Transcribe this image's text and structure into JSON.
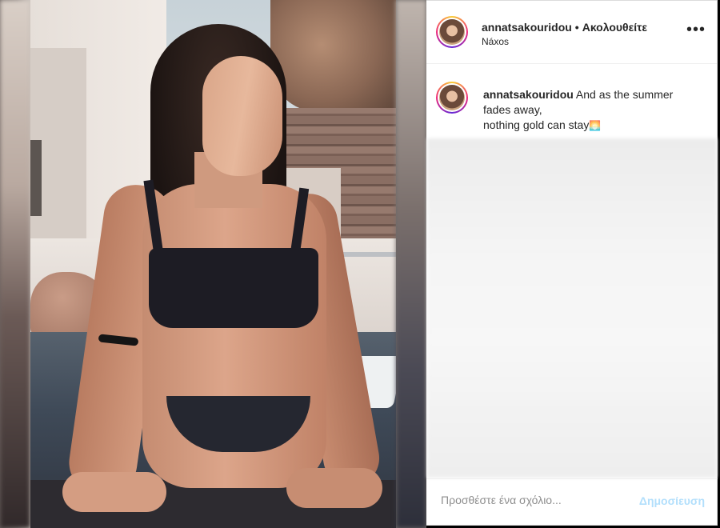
{
  "post": {
    "username": "annatsakouridou",
    "follow_status": "Ακολουθείτε",
    "separator": "•",
    "location": "Náxos",
    "more_icon": "more-options-icon"
  },
  "caption": {
    "username": "annatsakouridou",
    "text_line1": "And as the summer",
    "text_line2": "fades away,",
    "text_line3": "nothing gold can stay",
    "emoji": "🌅"
  },
  "comment_box": {
    "placeholder": "Προσθέστε ένα σχόλιο...",
    "post_label": "Δημοσίευση"
  },
  "colors": {
    "post_button_disabled": "#b2dffc",
    "text": "#262626",
    "secondary_text": "#8e8e8e"
  }
}
